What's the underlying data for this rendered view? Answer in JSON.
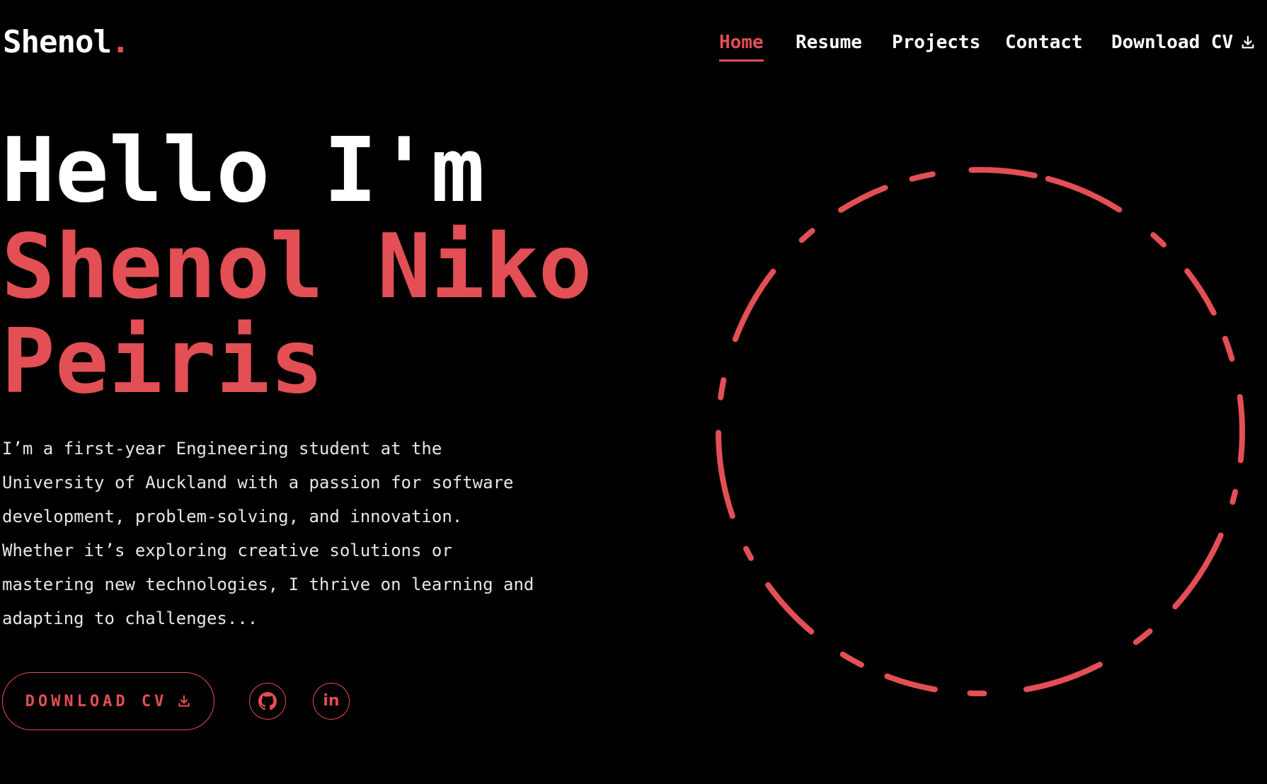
{
  "header": {
    "logo_text": "Shenol",
    "logo_dot": ".",
    "nav": [
      {
        "label": "Home",
        "active": true
      },
      {
        "label": "Resume"
      },
      {
        "label": "Projects"
      },
      {
        "label": "Contact"
      },
      {
        "label": "Download CV",
        "icon": "download-icon"
      }
    ]
  },
  "hero": {
    "greeting": "Hello I'm",
    "name_line1": "Shenol Niko",
    "name_line2": "Peiris",
    "bio": "I’m a first-year Engineering student at the\nUniversity of Auckland with a passion for software\ndevelopment, problem-solving, and innovation.\nWhether it’s exploring creative solutions or\nmastering new technologies, I thrive on learning and\nadapting to challenges...",
    "cta_label": "DOWNLOAD CV",
    "cta_icon": "download-icon",
    "socials": [
      {
        "name": "github",
        "icon": "github-icon"
      },
      {
        "name": "linkedin",
        "icon": "linkedin-icon",
        "text": "in"
      }
    ]
  },
  "colors": {
    "accent": "#e24f55",
    "background": "#000000",
    "text": "#ffffff"
  },
  "decoration": {
    "name": "dashed-ring",
    "style": "dashed"
  }
}
